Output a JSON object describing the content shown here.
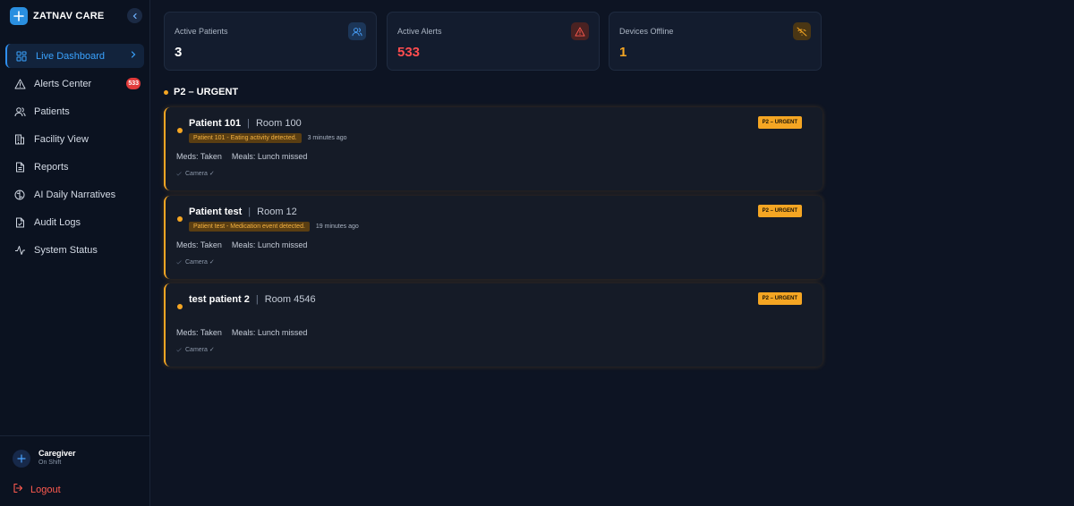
{
  "brand": {
    "name": "ZATNAV CARE"
  },
  "nav": [
    {
      "label": "Live Dashboard",
      "icon": "dashboard-icon",
      "active": true
    },
    {
      "label": "Alerts Center",
      "icon": "warning-icon",
      "badge": "533"
    },
    {
      "label": "Patients",
      "icon": "users-icon"
    },
    {
      "label": "Facility View",
      "icon": "building-icon"
    },
    {
      "label": "Reports",
      "icon": "document-icon"
    },
    {
      "label": "AI Daily Narratives",
      "icon": "brain-icon"
    },
    {
      "label": "Audit Logs",
      "icon": "file-check-icon"
    },
    {
      "label": "System Status",
      "icon": "activity-icon"
    }
  ],
  "user": {
    "name": "Caregiver",
    "status": "On Shift",
    "logout": "Logout"
  },
  "stats": [
    {
      "label": "Active Patients",
      "value": "3",
      "color": "#ffffff",
      "icon": "users-icon",
      "icon_bg": "#1c3658",
      "icon_color": "#4aa3ff"
    },
    {
      "label": "Active Alerts",
      "value": "533",
      "color": "#ff4d4f",
      "icon": "warning-icon",
      "icon_bg": "#4a2222",
      "icon_color": "#ff5a4f"
    },
    {
      "label": "Devices Offline",
      "value": "1",
      "color": "#f5a623",
      "icon": "wifi-off-icon",
      "icon_bg": "#4a3614",
      "icon_color": "#f5a623"
    }
  ],
  "section": {
    "title": "P2 – URGENT"
  },
  "alerts": [
    {
      "patient": "Patient 101",
      "room": "Room 100",
      "event": "Patient 101 - Eating activity detected.",
      "time": "3 minutes ago",
      "meds": "Meds: Taken",
      "meals": "Meals: Lunch missed",
      "device": "Camera ✓",
      "priority": "P2 – URGENT"
    },
    {
      "patient": "Patient test",
      "room": "Room 12",
      "event": "Patient test - Medication event detected.",
      "time": "19 minutes ago",
      "meds": "Meds: Taken",
      "meals": "Meals: Lunch missed",
      "device": "Camera ✓",
      "priority": "P2 – URGENT"
    },
    {
      "patient": "test patient 2",
      "room": "Room 4546",
      "event": "",
      "time": "",
      "meds": "Meds: Taken",
      "meals": "Meals: Lunch missed",
      "device": "Camera ✓",
      "priority": "P2 – URGENT"
    }
  ]
}
